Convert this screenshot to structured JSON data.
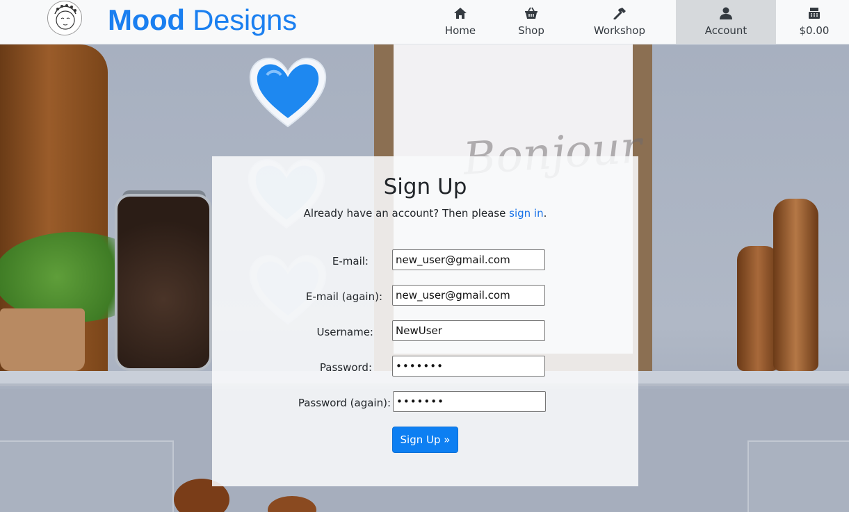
{
  "brand": {
    "word1": "Mood",
    "word2": "Designs",
    "logo_icon": "face-logo-icon",
    "color": "#1a7ff0"
  },
  "nav": {
    "items": [
      {
        "label": "Home",
        "icon": "home-icon"
      },
      {
        "label": "Shop",
        "icon": "basket-icon"
      },
      {
        "label": "Workshop",
        "icon": "hammer-icon"
      },
      {
        "label": "Account",
        "icon": "user-icon",
        "active": true
      }
    ],
    "cart_total": "$0.00",
    "cart_icon": "cash-register-icon"
  },
  "background": {
    "sign_text": "Bonjour"
  },
  "signup": {
    "title": "Sign Up",
    "subtitle_prefix": "Already have an account? Then please ",
    "signin_link": "sign in",
    "subtitle_suffix": ".",
    "fields": [
      {
        "label": "E-mail:",
        "value": "new_user@gmail.com",
        "type": "email"
      },
      {
        "label": "E-mail (again):",
        "value": "new_user@gmail.com",
        "type": "email"
      },
      {
        "label": "Username:",
        "value": "NewUser",
        "type": "text"
      },
      {
        "label": "Password:",
        "value": "•••••••",
        "type": "password"
      },
      {
        "label": "Password (again):",
        "value": "•••••••",
        "type": "password"
      }
    ],
    "submit_label": "Sign Up »",
    "accent_color": "#0d7ff2"
  }
}
